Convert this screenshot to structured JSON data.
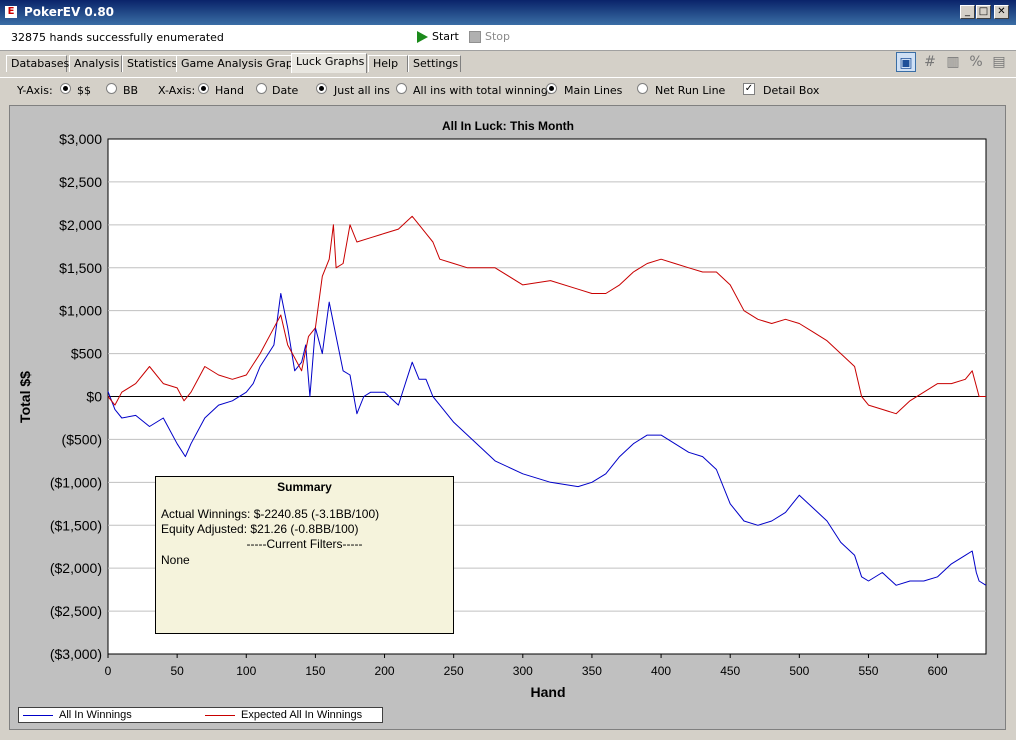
{
  "window": {
    "title": "PokerEV 0.80",
    "icon_text": "E"
  },
  "status": {
    "text": "32875 hands successfully enumerated",
    "start_label": "Start",
    "stop_label": "Stop"
  },
  "view_icons": [
    "image-view-icon",
    "grid-view-icon",
    "bar-chart-icon",
    "percent-icon",
    "notes-icon"
  ],
  "tabs": [
    {
      "label": "Databases",
      "active": false
    },
    {
      "label": "Analysis",
      "active": false
    },
    {
      "label": "Statistics",
      "active": false
    },
    {
      "label": "Game Analysis Graphs",
      "active": false
    },
    {
      "label": "Luck Graphs",
      "active": true
    },
    {
      "label": "Help",
      "active": false
    },
    {
      "label": "Settings",
      "active": false
    }
  ],
  "options": {
    "y_axis_label": "Y-Axis:",
    "y_dollars": "$$",
    "y_bb": "BB",
    "x_axis_label": "X-Axis:",
    "x_hand": "Hand",
    "x_date": "Date",
    "just_all_ins": "Just all ins",
    "all_ins_total": "All ins with total winnings",
    "main_lines": "Main Lines",
    "net_run_line": "Net Run Line",
    "detail_box": "Detail Box",
    "selected": {
      "y": "$$",
      "x": "Hand",
      "filter": "Just all ins",
      "lines": "Main Lines",
      "detail_box": true
    }
  },
  "summary": {
    "title": "Summary",
    "actual": "Actual Winnings: $-2240.85 (-3.1BB/100)",
    "equity": "Equity Adjusted: $21.26 (-0.8BB/100)",
    "filters_header": "-----Current Filters-----",
    "filters": "None"
  },
  "chart_data": {
    "type": "line",
    "title": "All In Luck: This Month",
    "xlabel": "Hand",
    "ylabel": "Total $$",
    "xlim": [
      0,
      635
    ],
    "ylim": [
      -3000,
      3000
    ],
    "x_ticks": [
      "0",
      "50",
      "100",
      "150",
      "200",
      "250",
      "300",
      "350",
      "400",
      "450",
      "500",
      "550",
      "600"
    ],
    "y_ticks": [
      "$3,000",
      "$2,500",
      "$2,000",
      "$1,500",
      "$1,000",
      "$500",
      "$0",
      "($500)",
      "($1,000)",
      "($1,500)",
      "($2,000)",
      "($2,500)",
      "($3,000)"
    ],
    "grid": true,
    "legend": "bottom-left",
    "series": [
      {
        "name": "All In Winnings",
        "color": "#0000c8",
        "x": [
          0,
          5,
          10,
          20,
          30,
          40,
          50,
          56,
          60,
          70,
          80,
          90,
          100,
          105,
          110,
          120,
          125,
          130,
          135,
          140,
          143,
          146,
          150,
          155,
          160,
          165,
          170,
          175,
          180,
          185,
          190,
          200,
          210,
          215,
          220,
          225,
          230,
          235,
          240,
          250,
          260,
          280,
          300,
          320,
          340,
          350,
          360,
          370,
          380,
          390,
          400,
          410,
          420,
          430,
          440,
          450,
          460,
          470,
          480,
          490,
          500,
          510,
          520,
          530,
          540,
          545,
          550,
          560,
          570,
          580,
          590,
          600,
          610,
          620,
          625,
          628,
          630,
          635
        ],
        "y": [
          60,
          -150,
          -250,
          -220,
          -350,
          -250,
          -550,
          -700,
          -550,
          -250,
          -100,
          -50,
          50,
          150,
          350,
          600,
          1200,
          800,
          300,
          400,
          600,
          0,
          800,
          500,
          1100,
          700,
          300,
          250,
          -200,
          0,
          50,
          50,
          -100,
          150,
          400,
          200,
          200,
          0,
          -100,
          -300,
          -450,
          -750,
          -900,
          -1000,
          -1050,
          -1000,
          -900,
          -700,
          -550,
          -450,
          -450,
          -550,
          -650,
          -700,
          -850,
          -1250,
          -1450,
          -1500,
          -1450,
          -1350,
          -1150,
          -1300,
          -1450,
          -1700,
          -1850,
          -2100,
          -2150,
          -2050,
          -2200,
          -2150,
          -2150,
          -2100,
          -1950,
          -1850,
          -1800,
          -2050,
          -2150,
          -2200
        ]
      },
      {
        "name": "Expected All In Winnings",
        "color": "#c80000",
        "x": [
          0,
          5,
          10,
          20,
          30,
          40,
          50,
          55,
          60,
          70,
          80,
          90,
          100,
          110,
          120,
          125,
          130,
          135,
          140,
          145,
          150,
          155,
          160,
          163,
          165,
          170,
          175,
          180,
          190,
          200,
          210,
          220,
          225,
          230,
          235,
          240,
          250,
          260,
          280,
          300,
          320,
          340,
          350,
          360,
          370,
          380,
          390,
          400,
          410,
          420,
          430,
          440,
          450,
          460,
          470,
          480,
          490,
          500,
          510,
          520,
          530,
          540,
          545,
          550,
          560,
          570,
          580,
          590,
          600,
          610,
          620,
          625,
          630,
          635
        ],
        "y": [
          0,
          -100,
          50,
          150,
          350,
          150,
          100,
          -50,
          50,
          350,
          250,
          200,
          250,
          500,
          800,
          950,
          600,
          450,
          300,
          700,
          800,
          1400,
          1600,
          2000,
          1500,
          1550,
          2000,
          1800,
          1850,
          1900,
          1950,
          2100,
          2000,
          1900,
          1800,
          1600,
          1550,
          1500,
          1500,
          1300,
          1350,
          1250,
          1200,
          1200,
          1300,
          1450,
          1550,
          1600,
          1550,
          1500,
          1450,
          1450,
          1300,
          1000,
          900,
          850,
          900,
          850,
          750,
          650,
          500,
          350,
          0,
          -100,
          -150,
          -200,
          -50,
          50,
          150,
          150,
          200,
          300,
          0,
          0
        ]
      }
    ]
  }
}
